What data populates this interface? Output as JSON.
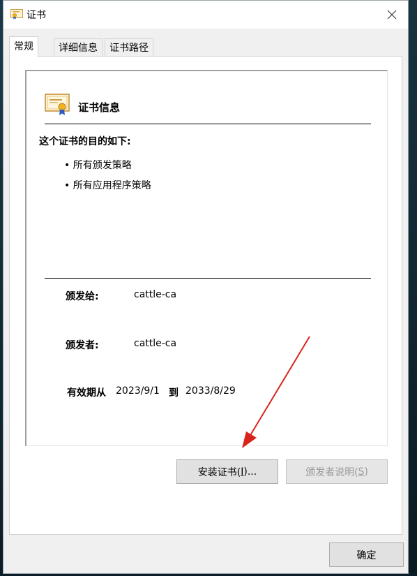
{
  "window": {
    "title": "证书"
  },
  "tabs": [
    {
      "label": "常规"
    },
    {
      "label": "详细信息"
    },
    {
      "label": "证书路径"
    }
  ],
  "cert": {
    "info_title": "证书信息",
    "purpose_heading": "这个证书的目的如下:",
    "purposes": [
      "所有颁发策略",
      "所有应用程序策略"
    ],
    "issued_to_label": "颁发给:",
    "issued_to_value": "cattle-ca",
    "issued_by_label": "颁发者:",
    "issued_by_value": "cattle-ca",
    "valid_label": "有效期从",
    "valid_from": "2023/9/1",
    "valid_to_label": "到",
    "valid_to": "2033/8/29"
  },
  "buttons": {
    "install_prefix": "安装证书(",
    "install_key": "I",
    "install_suffix": ")...",
    "issuer_prefix": "颁发者说明(",
    "issuer_key": "S",
    "issuer_suffix": ")",
    "ok": "确定"
  },
  "colors": {
    "annotation_arrow": "#d9241c",
    "window_bg": "#f0f0f0"
  }
}
